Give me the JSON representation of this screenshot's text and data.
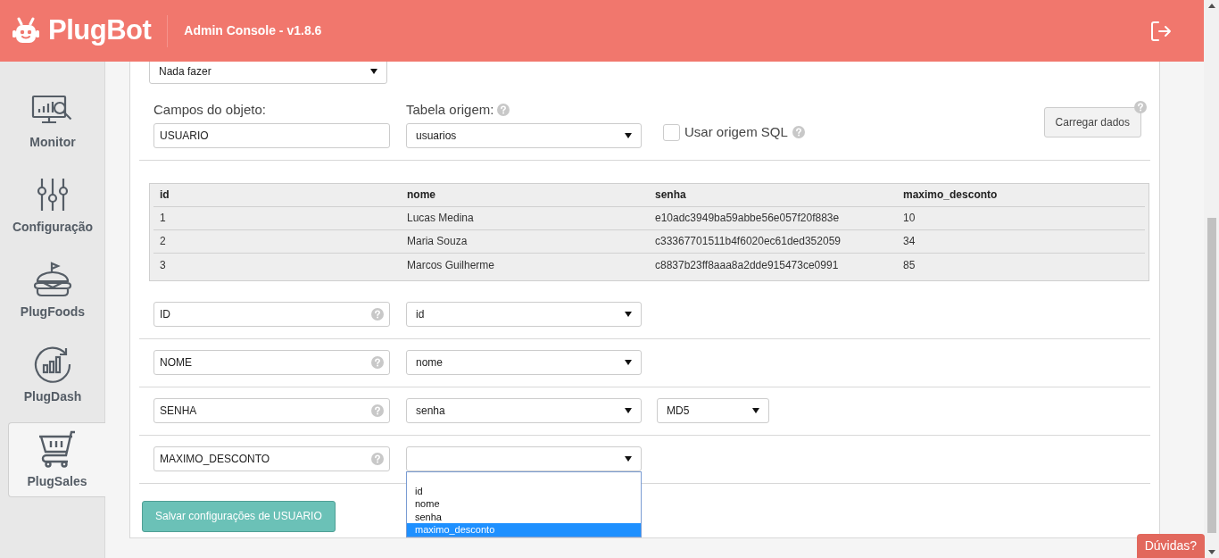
{
  "header": {
    "brand": "PlugBot",
    "subtitle": "Admin Console - v1.8.6"
  },
  "sidebar": {
    "items": [
      {
        "label": "Monitor",
        "kind": "monitor",
        "selected": false
      },
      {
        "label": "Configuração",
        "kind": "sliders",
        "selected": false
      },
      {
        "label": "PlugFoods",
        "kind": "burger",
        "selected": false
      },
      {
        "label": "PlugDash",
        "kind": "dash",
        "selected": false
      },
      {
        "label": "PlugSales",
        "kind": "cart",
        "selected": true
      }
    ]
  },
  "action_select": {
    "value": "Nada fazer"
  },
  "object_fields": {
    "label": "Campos do objeto:",
    "value": "USUARIO"
  },
  "source_table": {
    "label": "Tabela origem:",
    "value": "usuarios"
  },
  "sql_source": {
    "label": "Usar origem SQL",
    "checked": false
  },
  "load_button": "Carregar dados",
  "table": {
    "columns": [
      "id",
      "nome",
      "senha",
      "maximo_desconto"
    ],
    "rows": [
      [
        "1",
        "Lucas Medina",
        "e10adc3949ba59abbe56e057f20f883e",
        "10"
      ],
      [
        "2",
        "Maria Souza",
        "c33367701511b4f6020ec61ded352059",
        "34"
      ],
      [
        "3",
        "Marcos Guilherme",
        "c8837b23ff8aaa8a2dde915473ce0991",
        "85"
      ]
    ]
  },
  "mappings": [
    {
      "field": "ID",
      "column": "id"
    },
    {
      "field": "NOME",
      "column": "nome"
    },
    {
      "field": "SENHA",
      "column": "senha",
      "encoding": "MD5"
    },
    {
      "field": "MAXIMO_DESCONTO",
      "dropdown_open": true,
      "options": [
        {
          "label": "id",
          "selected": false
        },
        {
          "label": "nome",
          "selected": false
        },
        {
          "label": "senha",
          "selected": false
        },
        {
          "label": "maximo_desconto",
          "selected": true
        }
      ]
    }
  ],
  "save_button": "Salvar configurações de USUARIO",
  "help_button": "Dúvidas?"
}
